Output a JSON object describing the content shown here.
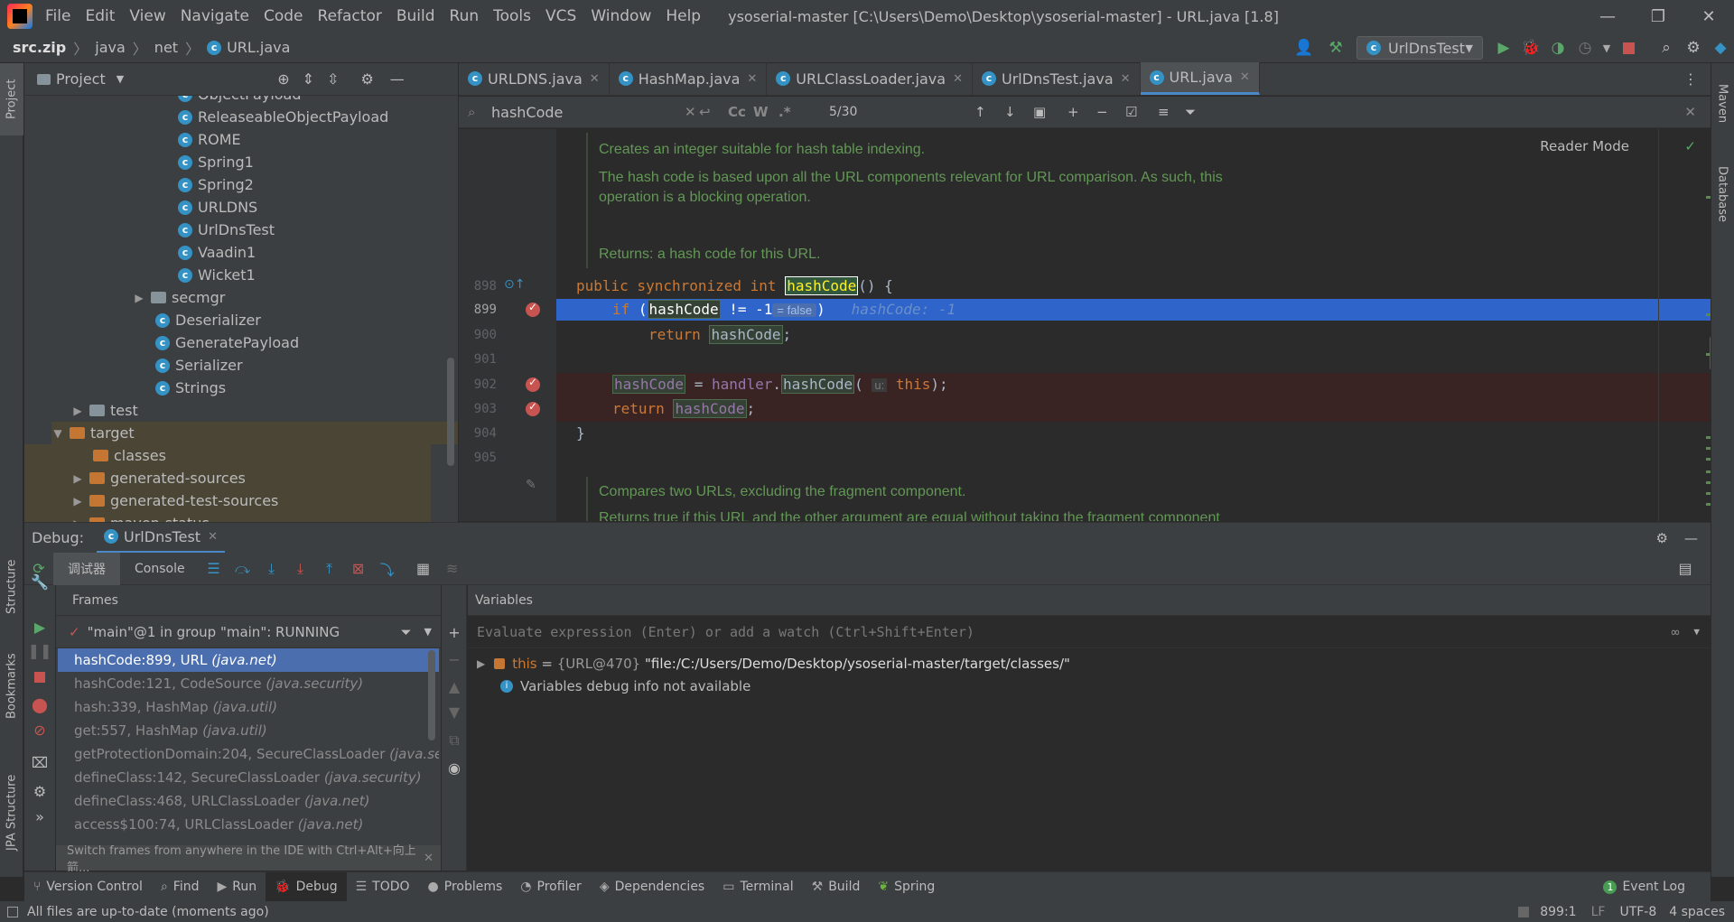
{
  "menubar": {
    "items": [
      "File",
      "Edit",
      "View",
      "Navigate",
      "Code",
      "Refactor",
      "Build",
      "Run",
      "Tools",
      "VCS",
      "Window",
      "Help"
    ],
    "title": "ysoserial-master [C:\\Users\\Demo\\Desktop\\ysoserial-master] - URL.java [1.8]"
  },
  "navbar": {
    "crumbs": [
      "src.zip",
      "java",
      "net",
      "URL.java"
    ],
    "run_config": "UrlDnsTest"
  },
  "side_tabs": {
    "project": "Project",
    "structure": "Structure",
    "bookmarks": "Bookmarks",
    "jpa": "JPA Structure",
    "maven": "Maven",
    "database": "Database"
  },
  "project": {
    "title": "Project",
    "tree": [
      {
        "label": "ObjectPayload",
        "kind": "class"
      },
      {
        "label": "ReleaseableObjectPayload",
        "kind": "class"
      },
      {
        "label": "ROME",
        "kind": "class"
      },
      {
        "label": "Spring1",
        "kind": "class"
      },
      {
        "label": "Spring2",
        "kind": "class"
      },
      {
        "label": "URLDNS",
        "kind": "class"
      },
      {
        "label": "UrlDnsTest",
        "kind": "class"
      },
      {
        "label": "Vaadin1",
        "kind": "class"
      },
      {
        "label": "Wicket1",
        "kind": "class"
      },
      {
        "label": "secmgr",
        "kind": "package"
      },
      {
        "label": "Deserializer",
        "kind": "class"
      },
      {
        "label": "GeneratePayload",
        "kind": "class"
      },
      {
        "label": "Serializer",
        "kind": "class"
      },
      {
        "label": "Strings",
        "kind": "class"
      },
      {
        "label": "test",
        "kind": "folder"
      },
      {
        "label": "target",
        "kind": "folder-orange"
      },
      {
        "label": "classes",
        "kind": "folder-orange"
      },
      {
        "label": "generated-sources",
        "kind": "folder-orange"
      },
      {
        "label": "generated-test-sources",
        "kind": "folder-orange"
      },
      {
        "label": "maven-status",
        "kind": "folder-orange"
      }
    ]
  },
  "editor_tabs": [
    "URLDNS.java",
    "HashMap.java",
    "URLClassLoader.java",
    "UrlDnsTest.java",
    "URL.java"
  ],
  "search": {
    "value": "hashCode",
    "match_count": "5/30",
    "case_label": "Cc",
    "word_label": "W",
    "regex_label": ".*"
  },
  "editor": {
    "reader_mode": "Reader Mode",
    "doc_lines": [
      "Creates an integer suitable for hash table indexing.",
      "The hash code is based upon all the URL components relevant for URL comparison. As such, this",
      "operation is a blocking operation.",
      "Returns: a hash code for this URL."
    ],
    "line_numbers": [
      "898",
      "899",
      "900",
      "901",
      "902",
      "903",
      "904",
      "905"
    ],
    "inline_false": "= false",
    "inline_value": "hashCode: -1",
    "param_hint": "u:",
    "doc_bottom": "Compares two URLs, excluding the fragment component.",
    "doc_bottom_2": "Returns true if this URL and the other argument are equal without taking the fragment component"
  },
  "debug": {
    "label": "Debug:",
    "session": "UrlDnsTest",
    "tab_debugger": "调试器",
    "tab_console": "Console",
    "frames_header": "Frames",
    "variables_header": "Variables",
    "thread": "\"main\"@1 in group \"main\": RUNNING",
    "frames": [
      {
        "method": "hashCode:899, URL",
        "pkg": "(java.net)"
      },
      {
        "method": "hashCode:121, CodeSource",
        "pkg": "(java.security)"
      },
      {
        "method": "hash:339, HashMap",
        "pkg": "(java.util)"
      },
      {
        "method": "get:557, HashMap",
        "pkg": "(java.util)"
      },
      {
        "method": "getProtectionDomain:204, SecureClassLoader",
        "pkg": "(java.sec"
      },
      {
        "method": "defineClass:142, SecureClassLoader",
        "pkg": "(java.security)"
      },
      {
        "method": "defineClass:468, URLClassLoader",
        "pkg": "(java.net)"
      },
      {
        "method": "access$100:74, URLClassLoader",
        "pkg": "(java.net)"
      }
    ],
    "hint": "Switch frames from anywhere in the IDE with Ctrl+Alt+向上箭...",
    "eval_placeholder": "Evaluate expression (Enter) or add a watch (Ctrl+Shift+Enter)",
    "var_this_name": "this",
    "var_this_eq": "=",
    "var_this_type": "{URL@470}",
    "var_this_value": "\"file:/C:/Users/Demo/Desktop/ysoserial-master/target/classes/\"",
    "var_info": "Variables debug info not available"
  },
  "bottom_tabs": [
    "Version Control",
    "Find",
    "Run",
    "Debug",
    "TODO",
    "Problems",
    "Profiler",
    "Dependencies",
    "Terminal",
    "Build",
    "Spring"
  ],
  "event_log": "Event Log",
  "event_count": "1",
  "status": {
    "message": "All files are up-to-date (moments ago)",
    "position": "899:1",
    "line_sep": "LF",
    "encoding": "UTF-8",
    "indent": "4 spaces"
  },
  "colors": {
    "accent": "#4a88c7",
    "selection": "#4b6eaf",
    "breakpoint": "#c75450",
    "breakpoint_line": "#3a2323",
    "doc_green": "#629755"
  }
}
